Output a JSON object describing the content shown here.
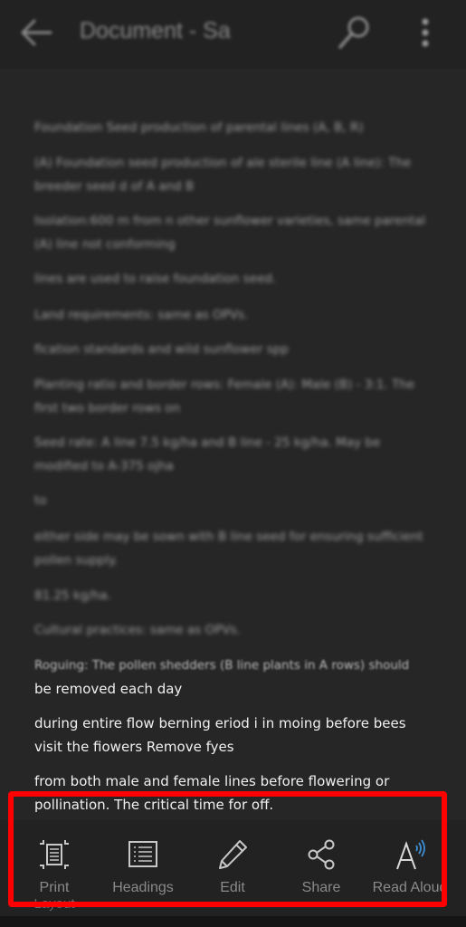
{
  "appbar": {
    "title": "Document - Sa",
    "back_icon": "arrow-left-icon",
    "search_icon": "search-icon",
    "more_icon": "more-vertical-icon"
  },
  "document": {
    "paragraphs": [
      "Foundation Seed production of parental lines (A, B, R)",
      "(A) Foundation seed production of ale sterile line (A line): The breeder seed d of A and B",
      "Isolation:600 m from n other sunflower varieties, same parental (A) line not conforming",
      "lines are used to raise foundation seed.",
      "Land requirements: same as OPVs.",
      "fication standards and wild sunflower spp",
      "Planting ratio and border rows: Female (A): Male (B) - 3:1. The first two border rows on",
      "Seed rate: A line 7.5 kg/ha and B line - 25 kg/ha. May be modified to A-375 ojha",
      "to",
      "either side may be sown with B line seed for ensuring sufficient pollen supply.",
      "81.25 kg/ha.",
      "Cultural practices: same as OPVs.",
      "Roguing: The pollen shedders (B line plants in A rows) should",
      "be removed each day",
      "during entire flow berning eriod i in moing before bees visit the fiowers Remove fyes",
      "from both male and female lines before flowering or pollination. The critical time for off."
    ]
  },
  "toolbar": {
    "items": [
      {
        "label": "Print",
        "label_line2": "Layout",
        "icon": "print-layout-icon"
      },
      {
        "label": "Headings",
        "icon": "headings-icon"
      },
      {
        "label": "Edit",
        "icon": "pencil-icon"
      },
      {
        "label": "Share",
        "icon": "share-icon"
      },
      {
        "label": "Read Aloud",
        "icon": "read-aloud-icon"
      }
    ]
  },
  "colors": {
    "annotation": "#ff0000",
    "read_aloud_accent": "#3d8fd6",
    "background": "#262626"
  }
}
